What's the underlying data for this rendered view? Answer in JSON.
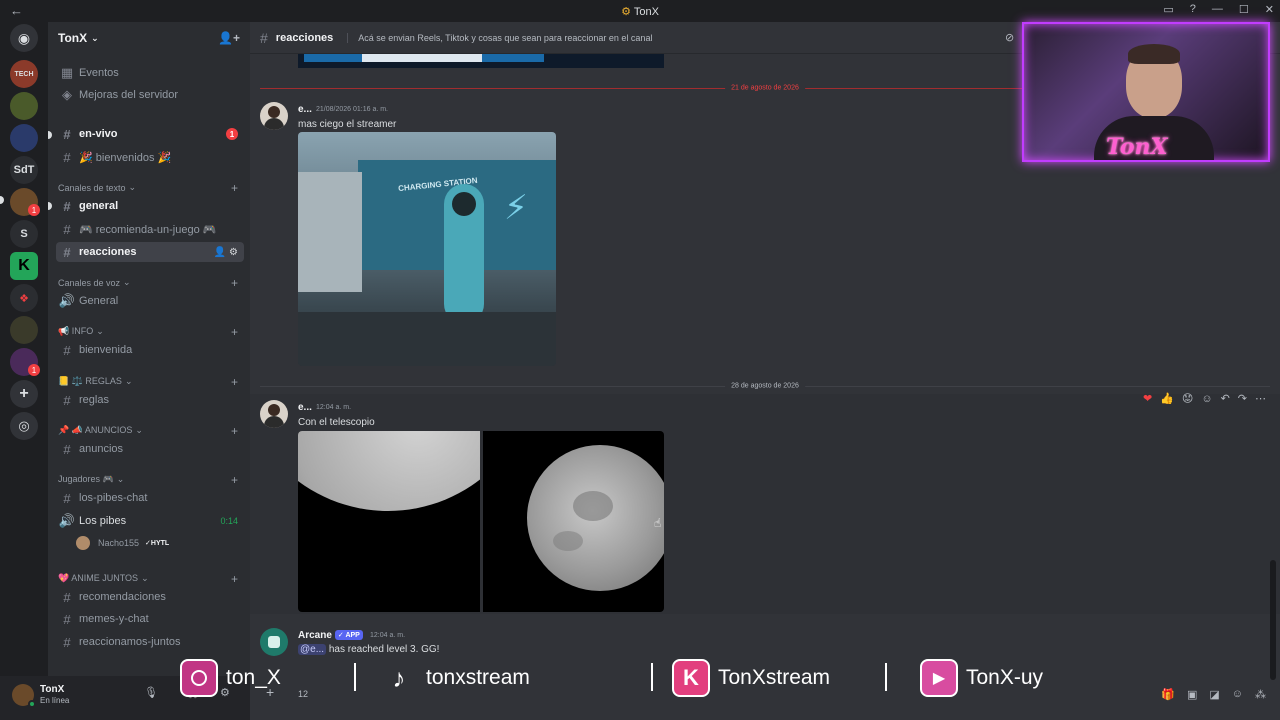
{
  "window": {
    "title": "TonX",
    "back_icon": "arrow-left-icon"
  },
  "guilds": [
    {
      "label": "",
      "color": "#5865f2"
    },
    {
      "label": "TECH",
      "color": "#8b3a2a"
    },
    {
      "label": "",
      "color": "#4a5a2a"
    },
    {
      "label": "",
      "color": "#2a3a6a"
    },
    {
      "label": "SdT",
      "color": "#2b2d31"
    },
    {
      "label": "",
      "color": "#6a4a2a"
    },
    {
      "label": "S",
      "color": "#2b2d31"
    },
    {
      "label": "K",
      "color": "#23a559"
    },
    {
      "label": "",
      "color": "#2b2d31"
    },
    {
      "label": "",
      "color": "#3a3a2a"
    },
    {
      "label": "",
      "color": "#4a2a5a"
    }
  ],
  "server": {
    "name": "TonX",
    "chevron": "⌄"
  },
  "sidebar": {
    "top_items": [
      {
        "label": "Eventos",
        "icon": "calendar-icon"
      },
      {
        "label": "Mejoras del servidor",
        "icon": "boost-icon"
      }
    ],
    "channels": [
      {
        "label": "en-vivo",
        "type": "text",
        "unread": true,
        "badge": "1"
      },
      {
        "label": "🎉 bienvenidos 🎉",
        "type": "text"
      },
      {
        "category": "Canales de texto"
      },
      {
        "label": "general",
        "type": "text",
        "unread": true
      },
      {
        "label": "🎮 recomienda-un-juego 🎮",
        "type": "text"
      },
      {
        "label": "reacciones",
        "type": "text",
        "active": true
      },
      {
        "category": "Canales de voz"
      },
      {
        "label": "General",
        "type": "voice"
      },
      {
        "category": "📢 INFO"
      },
      {
        "label": "bienvenida",
        "type": "text"
      },
      {
        "category": "📒 ⚖️ REGLAS"
      },
      {
        "label": "reglas",
        "type": "text"
      },
      {
        "category": "📌 📣 ANUNCIOS"
      },
      {
        "label": "anuncios",
        "type": "text"
      },
      {
        "category": "Jugadores 🎮"
      },
      {
        "label": "los-pibes-chat",
        "type": "text"
      },
      {
        "label": "Los pibes",
        "type": "voice-live",
        "time": "0:14"
      },
      {
        "label": "Nacho155",
        "type": "voice-user",
        "tag": "✓HYTL"
      },
      {
        "category": "💖 ANIME JUNTOS"
      },
      {
        "label": "recomendaciones",
        "type": "text"
      },
      {
        "label": "memes-y-chat",
        "type": "text"
      },
      {
        "label": "reaccionamos-juntos",
        "type": "text"
      }
    ]
  },
  "channel": {
    "name": "reacciones",
    "topic": "Acá se envian Reels, Tiktok y cosas que sean para reaccionar en el canal"
  },
  "messages": {
    "divider1": "21 de agosto de 2026",
    "msg1": {
      "author": "e...",
      "time": "21/08/2026 01:16 a. m.",
      "text": "mas ciego el streamer"
    },
    "divider2": "28 de agosto de 2026",
    "msg2": {
      "author": "e...",
      "time": "12:04 a. m.",
      "text": "Con el telescopio"
    },
    "msg3": {
      "author": "Arcane",
      "app": "✓ APP",
      "time": "12:04 a. m.",
      "mention": "@e...",
      "text": " has reached level 3. GG!"
    },
    "game_sign": "CHARGING STATION"
  },
  "toolbar": {
    "icons": [
      "heart-reaction",
      "thumbs-up-reaction",
      "sad-reaction",
      "add-reaction-icon",
      "reply-icon",
      "forward-icon",
      "more-icon"
    ],
    "glyphs": [
      "❤",
      "👍",
      "😟",
      "☺",
      "↶",
      "↷",
      "⋯"
    ]
  },
  "user": {
    "name": "TonX",
    "status": "En línea",
    "counter": "12"
  },
  "overlay": {
    "instagram": "ton_X",
    "tiktok": "tonxstream",
    "kick": "TonXstream",
    "youtube": "TonX-uy",
    "webcam_logo": "TonX"
  },
  "colors": {
    "accent": "#5865f2",
    "red": "#f23f42",
    "green": "#23a559",
    "instagram": "#c13584",
    "kick": "#e23f7e",
    "youtube": "#d84ca0"
  }
}
